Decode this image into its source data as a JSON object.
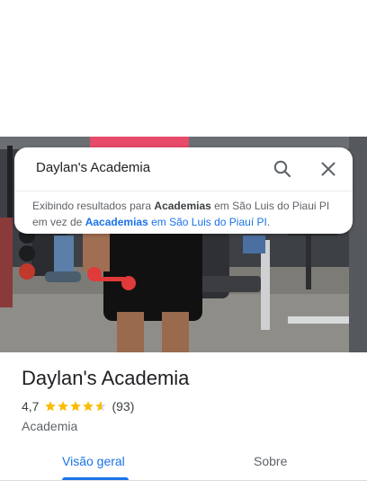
{
  "search": {
    "query": "Daylan's Academia"
  },
  "suggestion": {
    "prefix": "Exibindo resultados para ",
    "corrected_term": "Academias",
    "corrected_location": " em São Luis do Piaui PI",
    "middle": " em vez de ",
    "original_term": "Aacademias",
    "original_location": " em São Luis do Piauí PI",
    "suffix": "."
  },
  "place": {
    "name": "Daylan's Academia",
    "rating": "4,7",
    "rating_value": 4.7,
    "review_count": "(93)",
    "category": "Academia"
  },
  "tabs": [
    {
      "label": "Visão geral",
      "active": true
    },
    {
      "label": "Sobre",
      "active": false
    }
  ],
  "colors": {
    "accent": "#1a73e8",
    "star": "#fbbc04"
  },
  "icons": {
    "search": "search-icon",
    "close": "close-icon",
    "star": "star-icon"
  }
}
